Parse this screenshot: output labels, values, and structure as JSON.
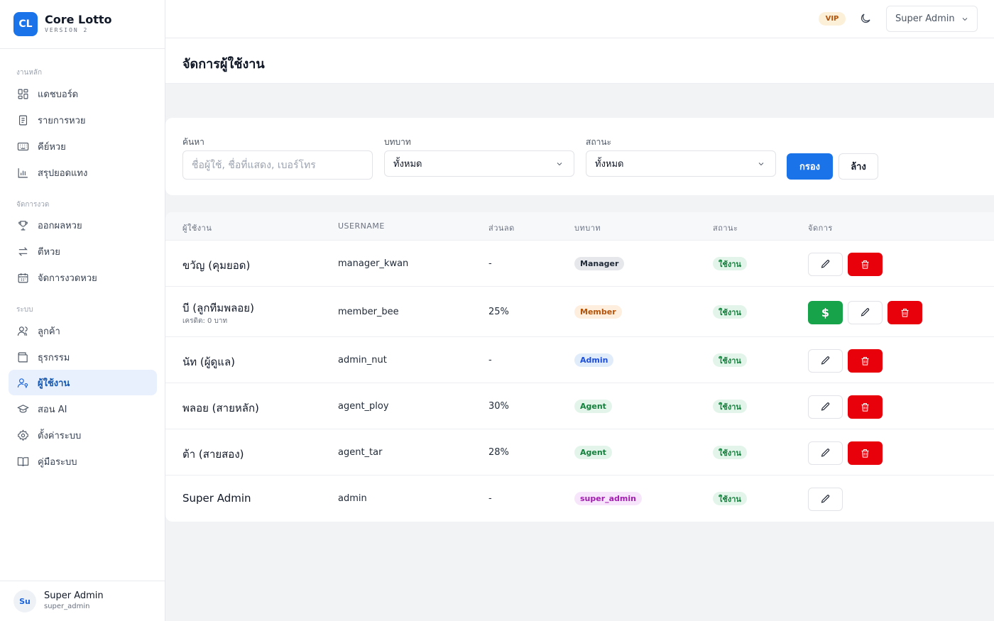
{
  "brand": {
    "logo": "CL",
    "name": "Core Lotto",
    "version": "VERSION 2"
  },
  "sidebar": {
    "sections": [
      {
        "label": "งานหลัก",
        "items": [
          {
            "label": "แดชบอร์ด",
            "icon": "dashboard-icon"
          },
          {
            "label": "รายการหวย",
            "icon": "document-icon"
          },
          {
            "label": "คีย์หวย",
            "icon": "keyboard-icon"
          },
          {
            "label": "สรุปยอดแทง",
            "icon": "bar-chart-icon"
          }
        ]
      },
      {
        "label": "จัดการงวด",
        "items": [
          {
            "label": "ออกผลหวย",
            "icon": "trophy-icon"
          },
          {
            "label": "ตีหวย",
            "icon": "swap-icon"
          },
          {
            "label": "จัดการงวดหวย",
            "icon": "calendar-icon"
          }
        ]
      },
      {
        "label": "ระบบ",
        "items": [
          {
            "label": "ลูกค้า",
            "icon": "users-icon"
          },
          {
            "label": "ธุรกรรม",
            "icon": "wallet-icon"
          },
          {
            "label": "ผู้ใช้งาน",
            "icon": "user-key-icon",
            "active": true
          },
          {
            "label": "สอน AI",
            "icon": "graduation-cap-icon"
          },
          {
            "label": "ตั้งค่าระบบ",
            "icon": "gear-icon"
          },
          {
            "label": "คู่มือระบบ",
            "icon": "book-icon"
          }
        ]
      }
    ]
  },
  "user": {
    "initials": "Su",
    "name": "Super Admin",
    "role": "super_admin"
  },
  "topbar": {
    "vip": "VIP",
    "account": "Super Admin"
  },
  "page": {
    "title": "จัดการผู้ใช้งาน"
  },
  "filters": {
    "search_label": "ค้นหา",
    "search_placeholder": "ชื่อผู้ใช้, ชื่อที่แสดง, เบอร์โทร",
    "role_label": "บทบาท",
    "role_value": "ทั้งหมด",
    "status_label": "สถานะ",
    "status_value": "ทั้งหมด",
    "filter_button": "กรอง",
    "clear_button": "ล้าง"
  },
  "table": {
    "headers": [
      "ผู้ใช้งาน",
      "USERNAME",
      "ส่วนลด",
      "บทบาท",
      "สถานะ",
      "จัดการ"
    ],
    "rows": [
      {
        "name": "ขวัญ (คุมยอด)",
        "username": "manager_kwan",
        "discount": "-",
        "role": "Manager",
        "role_bg": "#e5e7eb",
        "role_fg": "#1f2937",
        "status": "ใช้งาน",
        "actions": [
          "edit",
          "delete"
        ]
      },
      {
        "name": "บี (ลูกทีมพลอย)",
        "credit": "เครดิต: 0 บาท",
        "username": "member_bee",
        "discount": "25%",
        "role": "Member",
        "role_bg": "#fdeedd",
        "role_fg": "#b45309",
        "status": "ใช้งาน",
        "actions": [
          "money",
          "edit",
          "delete"
        ]
      },
      {
        "name": "นัท (ผู้ดูแล)",
        "username": "admin_nut",
        "discount": "-",
        "role": "Admin",
        "role_bg": "#e1ecfb",
        "role_fg": "#1d4ed8",
        "status": "ใช้งาน",
        "actions": [
          "edit",
          "delete"
        ]
      },
      {
        "name": "พลอย (สายหลัก)",
        "username": "agent_ploy",
        "discount": "30%",
        "role": "Agent",
        "role_bg": "#e3f5ea",
        "role_fg": "#15803d",
        "status": "ใช้งาน",
        "actions": [
          "edit",
          "delete"
        ]
      },
      {
        "name": "ต้า (สายสอง)",
        "username": "agent_tar",
        "discount": "28%",
        "role": "Agent",
        "role_bg": "#e3f5ea",
        "role_fg": "#15803d",
        "status": "ใช้งาน",
        "actions": [
          "edit",
          "delete"
        ]
      },
      {
        "name": "Super Admin",
        "username": "admin",
        "discount": "-",
        "role": "super_admin",
        "role_bg": "#f7e6fb",
        "role_fg": "#a21caf",
        "status": "ใช้งาน",
        "actions": [
          "edit"
        ]
      }
    ]
  }
}
